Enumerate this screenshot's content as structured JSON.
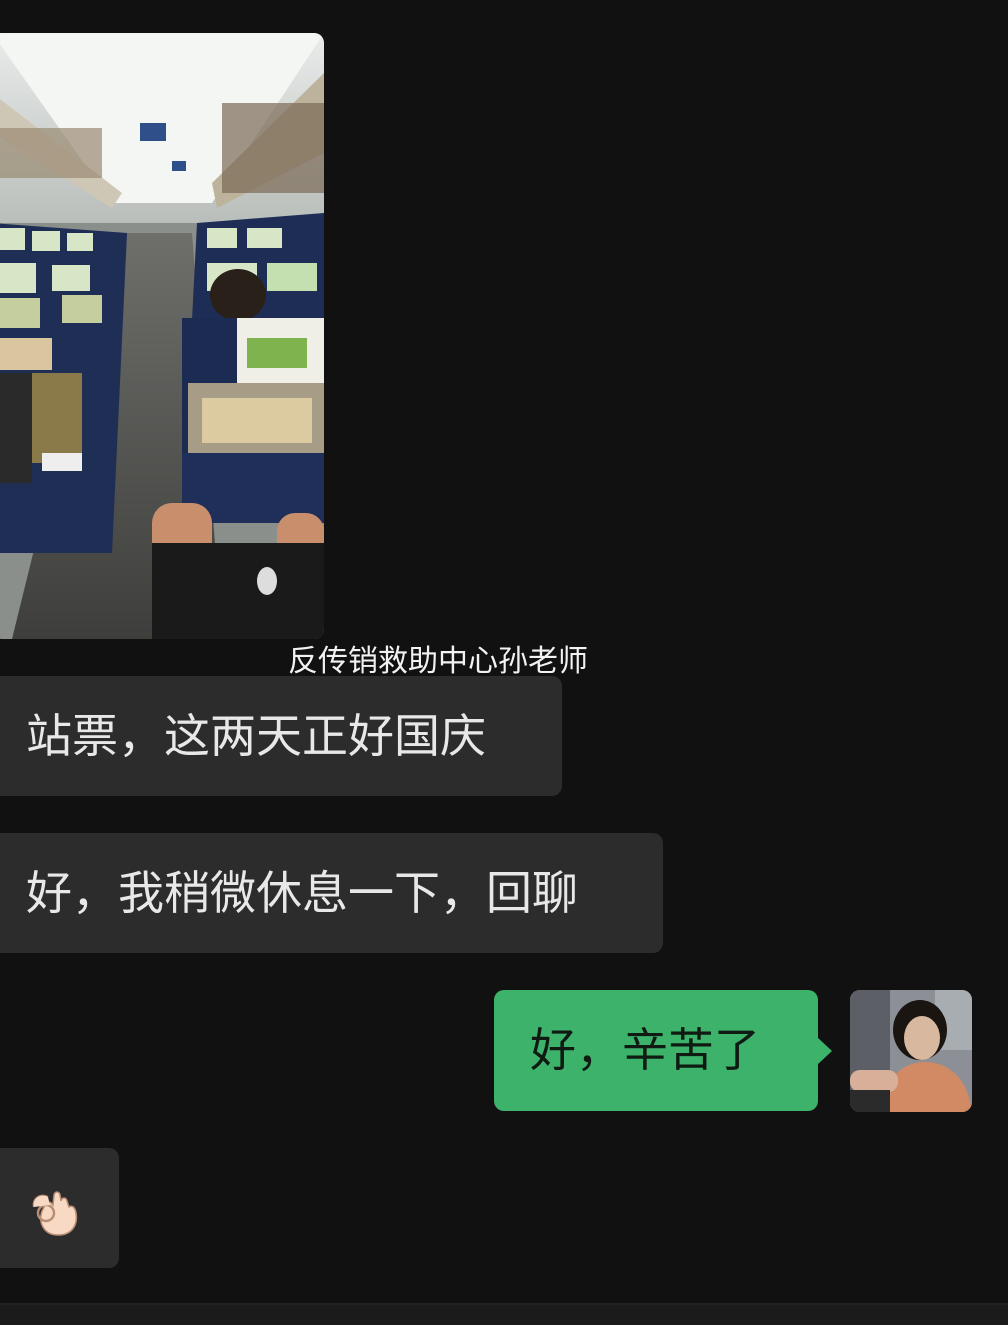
{
  "messages": {
    "photo": {
      "icon": "train-interior-photo"
    },
    "sender_watermark": "反传销救助中心孙老师",
    "incoming_1": "站票，这两天正好国庆",
    "incoming_2": "好，我稍微休息一下，回聊",
    "outgoing_1": "好，辛苦了",
    "incoming_3": {
      "icon": "ok-hand-emoji"
    }
  },
  "colors": {
    "background": "#111111",
    "incoming_bubble": "#2c2c2c",
    "outgoing_bubble": "#3db26b"
  }
}
